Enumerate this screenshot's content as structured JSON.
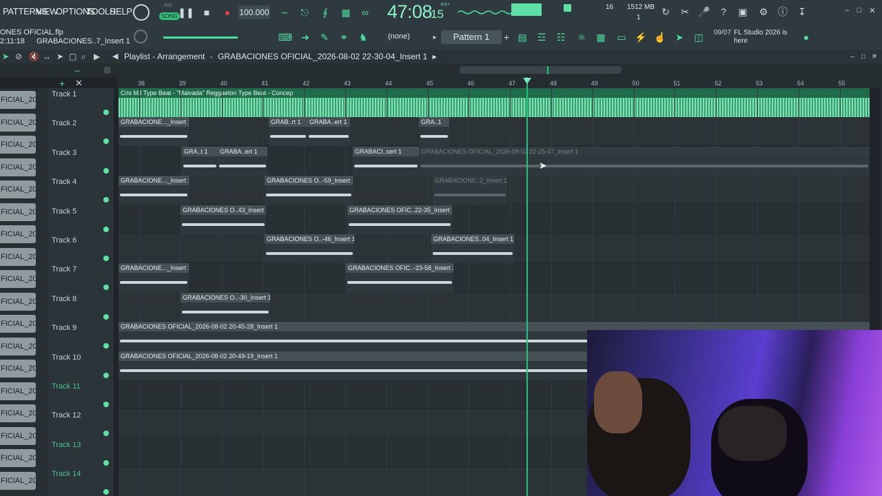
{
  "menu": [
    "PATTERNS",
    "VIEW",
    "OPTIONS",
    "TOOLS",
    "HELP"
  ],
  "transport": {
    "pat_label": "PAT",
    "song_label": "SONG",
    "tempo": "100.000",
    "time_main": "47:08",
    "time_frac": "15",
    "time_unit": "B:S:T"
  },
  "status": {
    "cpu_num": "16",
    "memory": "1512 MB",
    "voices": "1"
  },
  "file": {
    "title": "ONES OFICIAL.flp",
    "song_time": "2:11:18",
    "hint": "GRABACIONES..7_Insert 1"
  },
  "pattern": {
    "selector_value": "(none)",
    "pattern_label": "Pattern 1"
  },
  "news": {
    "date": "09/07",
    "text": "FL Studio 2026 is here"
  },
  "playlist": {
    "title": "Playlist - Arrangement",
    "arrangement": "GRABACIONES OFICIAL_2026-08-02 22-30-04_Insert 1"
  },
  "ruler": [
    "38",
    "39",
    "40",
    "41",
    "42",
    "43",
    "44",
    "45",
    "46",
    "47",
    "48",
    "49",
    "50",
    "51",
    "52",
    "53",
    "54",
    "55"
  ],
  "picker": [
    "FICIAL_20..",
    "FICIAL_20..",
    "FICIAL_20..",
    "FICIAL_20..",
    "FICIAL_20..",
    "FICIAL_20..",
    "FICIAL_20..",
    "FICIAL_20..",
    "FICIAL_20..",
    "FICIAL_20..",
    "FICIAL_20..",
    "FICIAL_20..",
    "FICIAL_20..",
    "FICIAL_20..",
    "FICIAL_20..",
    "FICIAL_20..",
    "FICIAL_20..",
    "FICIAL_20.."
  ],
  "tracks": [
    "Track 1",
    "Track 2",
    "Track 3",
    "Track 4",
    "Track 5",
    "Track 6",
    "Track 7",
    "Track 8",
    "Track 9",
    "Track 10",
    "Track 11",
    "Track 12",
    "Track 13",
    "Track 14"
  ],
  "clips": {
    "t1": "Cris MJ Type Beat - \"Malvada\" Reggaeton Type Beat - Concep",
    "t2a": "GRABACIONE..._Insert 1",
    "t2b": "GRAB..rt 1",
    "t2c": "GRABA..ert 1",
    "t2d": "GRA..1",
    "t3a": "GRA..t 1",
    "t3b": "GRABA..ert 1",
    "t3c": "GRABACI..sert 1",
    "t3d": "GRABACIONES OFICIAL_2026-08-02 22-25-47_Insert 1",
    "t4a": "GRABACIONE..._Insert 1",
    "t4b": "GRABACIONES O..-59_Insert 1",
    "t4c": "GRABACIONE..2_Insert 1",
    "t5a": "GRABACIONES O..43_Insert 1",
    "t5b": "GRABACIONES OFIC..22-35_Insert 1",
    "t6a": "GRABACIONES O..-46_Insert 1",
    "t6b": "GRABACIONES..04_Insert 1",
    "t7a": "GRABACIONE..._Insert 1",
    "t7b": "GRABACIONES OFIC..-23-58_Insert 1",
    "t8a": "GRABACIONES O..-30_Insert 1",
    "t9": "GRABACIONES OFICIAL_2026-08-02 20-45-28_Insert 1",
    "t10": "GRABACIONES OFICIAL_2026-08-02 20-49-19_Insert 1"
  },
  "colors": {
    "accent": "#4fdc9c",
    "playhead": "#27c27c",
    "clip": "#465157"
  }
}
